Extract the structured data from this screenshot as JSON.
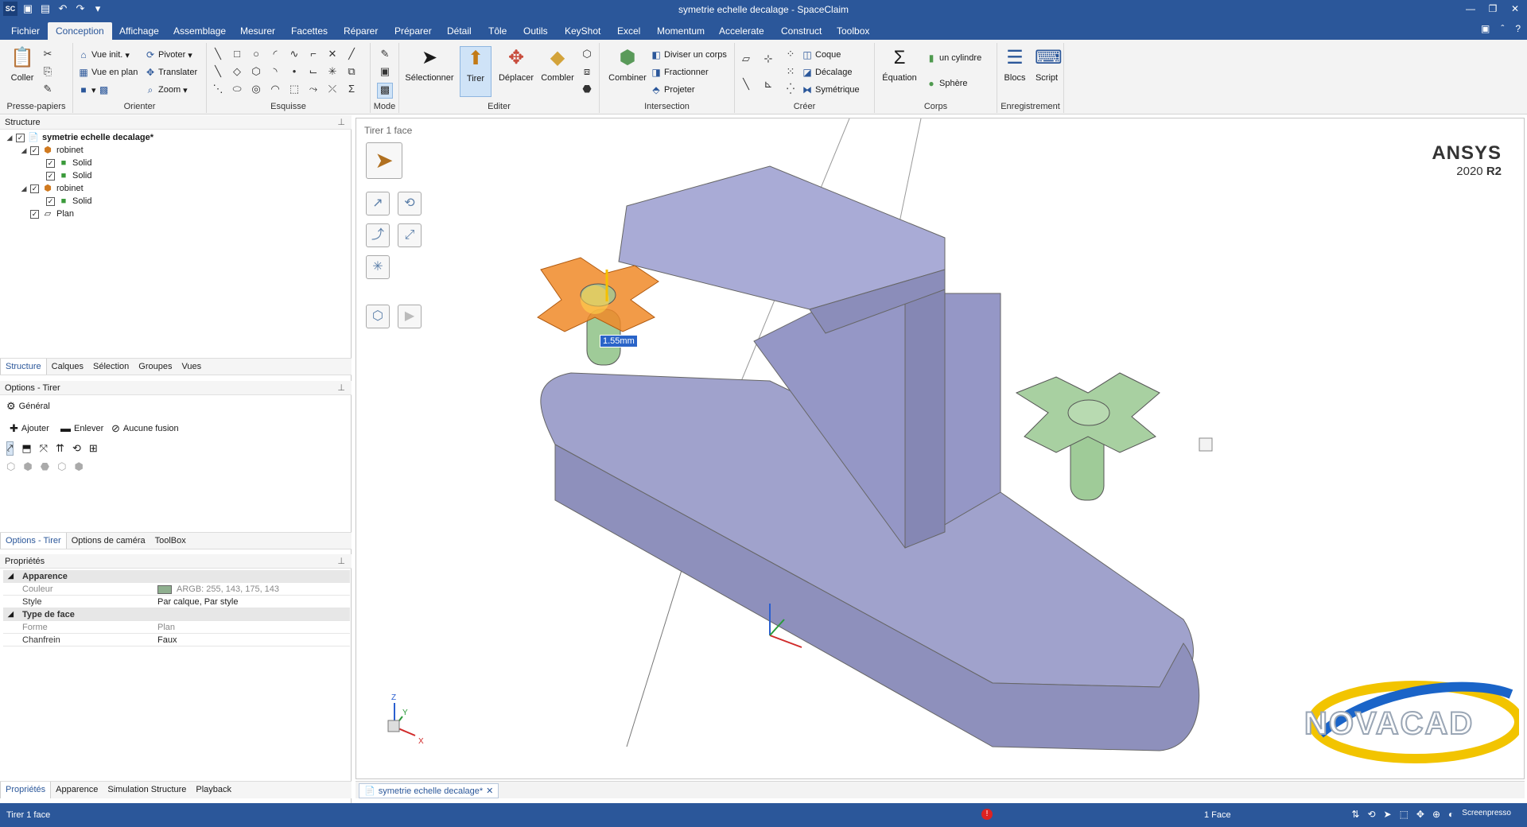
{
  "window": {
    "title": "symetrie echelle decalage - SpaceClaim",
    "app_logo": "SC",
    "qat_icons": [
      "open-icon",
      "save-icon",
      "undo-icon",
      "redo-icon",
      "customize-icon"
    ],
    "controls": [
      "minimize-icon",
      "restore-icon",
      "close-icon"
    ]
  },
  "menu": {
    "tabs": [
      "Fichier",
      "Conception",
      "Affichage",
      "Assemblage",
      "Mesurer",
      "Facettes",
      "Réparer",
      "Préparer",
      "Détail",
      "Tôle",
      "Outils",
      "KeyShot",
      "Excel",
      "Momentum",
      "Accelerate",
      "Construct",
      "Toolbox"
    ],
    "active_tab": "Conception"
  },
  "ribbon": {
    "clipboard": {
      "label": "Presse-papiers",
      "paste": "Coller"
    },
    "orient": {
      "label": "Orienter",
      "home_view": "Vue init.",
      "plan_view": "Vue en plan",
      "pivot": "Pivoter",
      "translate": "Translater",
      "zoom": "Zoom"
    },
    "sketch": {
      "label": "Esquisse"
    },
    "mode": {
      "label": "Mode"
    },
    "edit": {
      "label": "Editer",
      "select": "Sélectionner",
      "pull": "Tirer",
      "move": "Déplacer",
      "fill": "Combler"
    },
    "intersection": {
      "label": "Intersection",
      "combine": "Combiner",
      "split_body": "Diviser un corps",
      "split": "Fractionner",
      "project": "Projeter"
    },
    "create": {
      "label": "Créer",
      "shell": "Coque",
      "offset": "Décalage",
      "symmetric": "Symétrique"
    },
    "body": {
      "label": "Corps",
      "equation": "Équation",
      "cylinder": "un cylindre",
      "sphere": "Sphère"
    },
    "record": {
      "label": "Enregistrement",
      "blocks": "Blocs",
      "script": "Script"
    }
  },
  "structure": {
    "header": "Structure",
    "items": [
      {
        "label": "symetrie echelle decalage*",
        "level": 0,
        "bold": true,
        "icon": "part-icon"
      },
      {
        "label": "robinet",
        "level": 1,
        "icon": "component-icon"
      },
      {
        "label": "Solid",
        "level": 2,
        "icon": "solid-icon"
      },
      {
        "label": "Solid",
        "level": 2,
        "icon": "solid-icon"
      },
      {
        "label": "robinet",
        "level": 1,
        "icon": "component-icon"
      },
      {
        "label": "Solid",
        "level": 2,
        "icon": "solid-icon"
      },
      {
        "label": "Plan",
        "level": 1,
        "icon": "plane-icon"
      }
    ],
    "tabs": [
      "Structure",
      "Calques",
      "Sélection",
      "Groupes",
      "Vues"
    ],
    "active_tab": "Structure"
  },
  "options": {
    "header": "Options - Tirer",
    "general": "Général",
    "add": "Ajouter",
    "remove": "Enlever",
    "no_merge": "Aucune fusion",
    "tabs": [
      "Options - Tirer",
      "Options de caméra",
      "ToolBox"
    ],
    "active_tab": "Options - Tirer"
  },
  "properties": {
    "header": "Propriétés",
    "sections": [
      {
        "title": "Apparence",
        "rows": [
          {
            "key": "Couleur",
            "value": "ARGB: 255, 143, 175, 143",
            "swatch": "#8faf8f",
            "dim": true
          },
          {
            "key": "Style",
            "value": "Par calque, Par style",
            "dim": false
          }
        ]
      },
      {
        "title": "Type de face",
        "rows": [
          {
            "key": "Forme",
            "value": "Plan",
            "dim": true
          },
          {
            "key": "Chanfrein",
            "value": "Faux",
            "dim": false
          }
        ]
      }
    ],
    "bottom_tabs": [
      "Propriétés",
      "Apparence",
      "Simulation Structure",
      "Playback"
    ],
    "active_tab": "Propriétés"
  },
  "viewport": {
    "tool_title": "Tirer 1 face",
    "brand": "ANSYS",
    "version_prefix": "2020 ",
    "version_suffix": "R2",
    "dimension": "1.55mm",
    "watermark": "NOVACAD",
    "doc_tab": "symetrie echelle decalage*",
    "axis_z": "Z",
    "axis_y": "Y",
    "axis_x": "X",
    "colors": {
      "body": "#a3a5d0",
      "face_orange": "#f08a28",
      "knob_green": "#9fcb98"
    }
  },
  "status": {
    "left": "Tirer 1 face",
    "selection": "1 Face",
    "warning": "!",
    "brand": "Screenpresso"
  }
}
